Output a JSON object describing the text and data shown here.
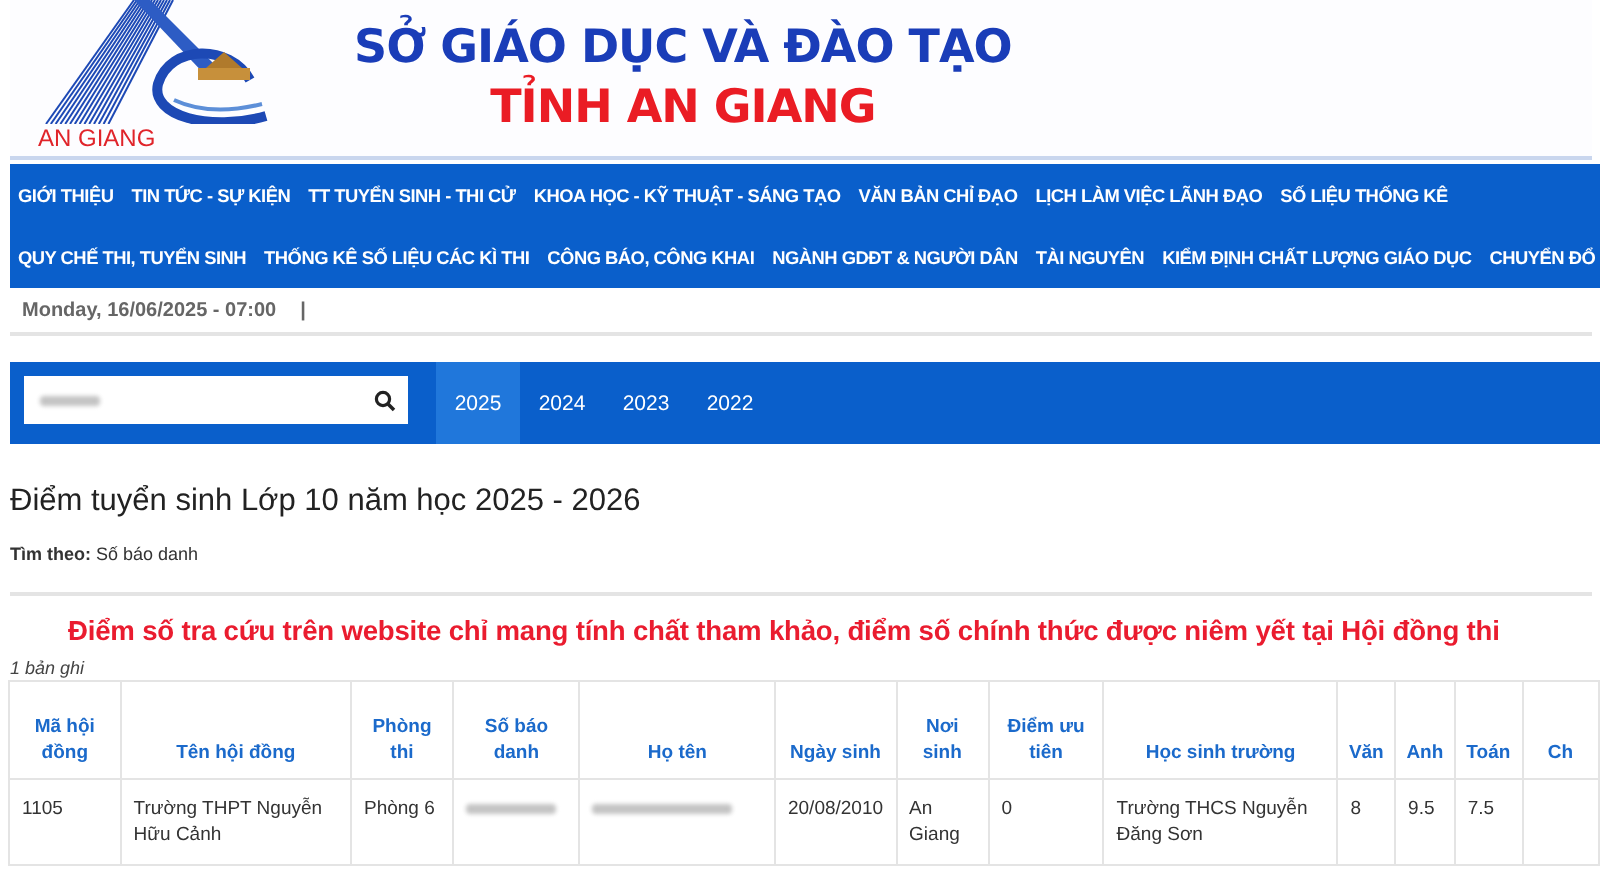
{
  "header": {
    "logo_text": "AN GIANG",
    "title": "SỞ GIÁO DỤC VÀ ĐÀO TẠO",
    "subtitle": "TỈNH AN GIANG"
  },
  "nav": {
    "top_links": [
      "GIỚI THIỆU",
      "TIN TỨC - SỰ KIỆN",
      "TT TUYỂN SINH - THI CỬ",
      "KHOA HỌC - KỸ THUẬT - SÁNG TẠO",
      "VĂN BẢN CHỈ ĐẠO",
      "LỊCH LÀM VIỆC LÃNH ĐẠO",
      "SỐ LIỆU THỐNG KÊ"
    ],
    "bottom_links": [
      "QUY CHẾ THI, TUYỂN SINH",
      "THỐNG KÊ SỐ LIỆU CÁC KÌ THI",
      "CÔNG BÁO, CÔNG KHAI",
      "NGÀNH GDĐT & NGƯỜI DÂN",
      "TÀI NGUYÊN",
      "KIỂM ĐỊNH CHẤT LƯỢNG GIÁO DỤC",
      "CHUYỂN ĐỔ"
    ]
  },
  "date_line": "Monday, 16/06/2025 - 07:00",
  "date_separator": "|",
  "search": {
    "value_redacted": true
  },
  "year_tabs": [
    {
      "label": "2025",
      "selected": true
    },
    {
      "label": "2024",
      "selected": false
    },
    {
      "label": "2023",
      "selected": false
    },
    {
      "label": "2022",
      "selected": false
    }
  ],
  "page_title": "Điểm tuyển sinh Lớp 10 năm học 2025 - 2026",
  "search_by": {
    "label": "Tìm theo:",
    "value": "Số báo danh"
  },
  "notice": "Điểm số tra cứu trên website chỉ mang tính chất tham khảo, điểm số chính thức được niêm yết tại Hội đồng thi",
  "record_count": "1 bản ghi",
  "table": {
    "columns": [
      "Mã hội đồng",
      "Tên hội đồng",
      "Phòng thi",
      "Số báo danh",
      "Họ tên",
      "Ngày sinh",
      "Nơi sinh",
      "Điểm ưu tiên",
      "Học sinh trường",
      "Văn",
      "Anh",
      "Toán",
      "Ch"
    ],
    "rows": [
      [
        {
          "kind": "text",
          "text": "1105"
        },
        {
          "kind": "text",
          "text": "Trường THPT Nguyễn Hữu Cảnh"
        },
        {
          "kind": "text",
          "text": "Phòng 6"
        },
        {
          "kind": "redacted"
        },
        {
          "kind": "redacted"
        },
        {
          "kind": "text",
          "text": "20/08/2010"
        },
        {
          "kind": "text",
          "text": "An Giang"
        },
        {
          "kind": "text",
          "text": "0"
        },
        {
          "kind": "text",
          "text": "Trường THCS Nguyễn Đăng Sơn"
        },
        {
          "kind": "text",
          "text": "8"
        },
        {
          "kind": "text",
          "text": "9.5"
        },
        {
          "kind": "text",
          "text": "7.5"
        },
        {
          "kind": "empty"
        }
      ]
    ]
  }
}
